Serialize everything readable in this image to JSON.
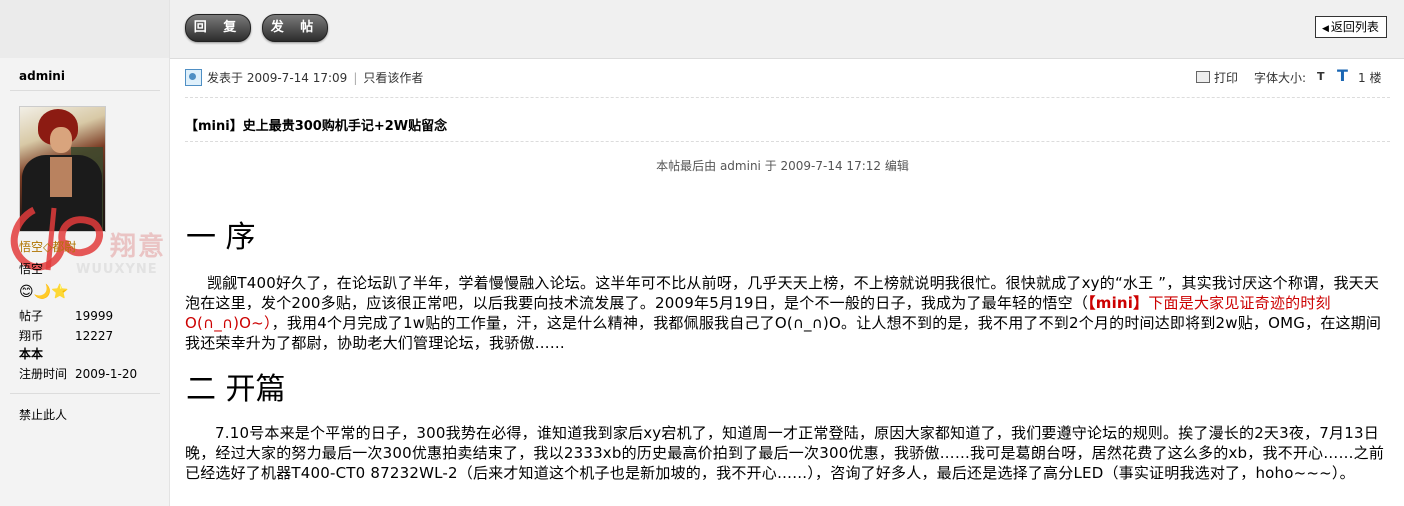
{
  "toolbar": {
    "reply_label": "回 复",
    "post_label": "发 帖",
    "back_label": "返回列表"
  },
  "user": {
    "name": "admini",
    "rank": "悟空◇都尉",
    "title": "悟空",
    "watermark": "翔意",
    "watermark_sub": "WUUXYNE",
    "badges": "😊🌙⭐",
    "stats": [
      {
        "label": "帖子",
        "value": "19999"
      },
      {
        "label": "翔币",
        "value": "12227"
      },
      {
        "label": "本本",
        "value": ""
      },
      {
        "label": "注册时间",
        "value": "2009-1-20"
      }
    ],
    "ban_label": "禁止此人"
  },
  "post": {
    "posted_at": "发表于 2009-7-14 17:09",
    "only_author": "只看该作者",
    "print_label": "打印",
    "fontsize_label": "字体大小:",
    "font_small": "T",
    "font_large": "T",
    "floor": "1 楼",
    "title": "【mini】史上最贵300购机手记+2W贴留念",
    "edit_note": "本帖最后由 admini 于 2009-7-14 17:12 编辑"
  },
  "body": {
    "section1_heading": "一  序",
    "para1_a": "觊觎T400好久了，在论坛趴了半年，学着慢慢融入论坛。这半年可不比从前呀，几乎天天上榜，不上榜就说明我很忙。很快就成了xy的“水王 ”，其实我讨厌这个称谓，我天天泡在这里，发个200多贴，应该很正常吧，以后我要向技术流发展了。2009年5月19日，是个不一般的日子，我成为了最年轻的悟空（",
    "para1_b": "【mini】",
    "para1_c": "下面是大家见证奇迹的时刻O(∩_∩)O~）",
    "para1_d": "，我用4个月完成了1w贴的工作量，汗，这是什么精神，我都佩服我自己了O(∩_∩)O。让人想不到的是，我不用了不到2个月的时间达即将到2w贴，OMG，在这期间我还荣幸升为了都尉，协助老大们管理论坛，我骄傲……",
    "section2_heading": "二  开篇",
    "para2": "7.10号本来是个平常的日子，300我势在必得，谁知道我到家后xy宕机了，知道周一才正常登陆，原因大家都知道了，我们要遵守论坛的规则。挨了漫长的2天3夜，7月13日晚，经过大家的努力最后一次300优惠拍卖结束了，我以2333xb的历史最高价拍到了最后一次300优惠，我骄傲……我可是葛朗台呀，居然花费了这么多的xb，我不开心……之前已经选好了机器T400-CT0 87232WL-2（后来才知道这个机子也是新加坡的，我不开心……），咨询了好多人，最后还是选择了高分LED（事实证明我选对了，hoho~~~）。"
  }
}
